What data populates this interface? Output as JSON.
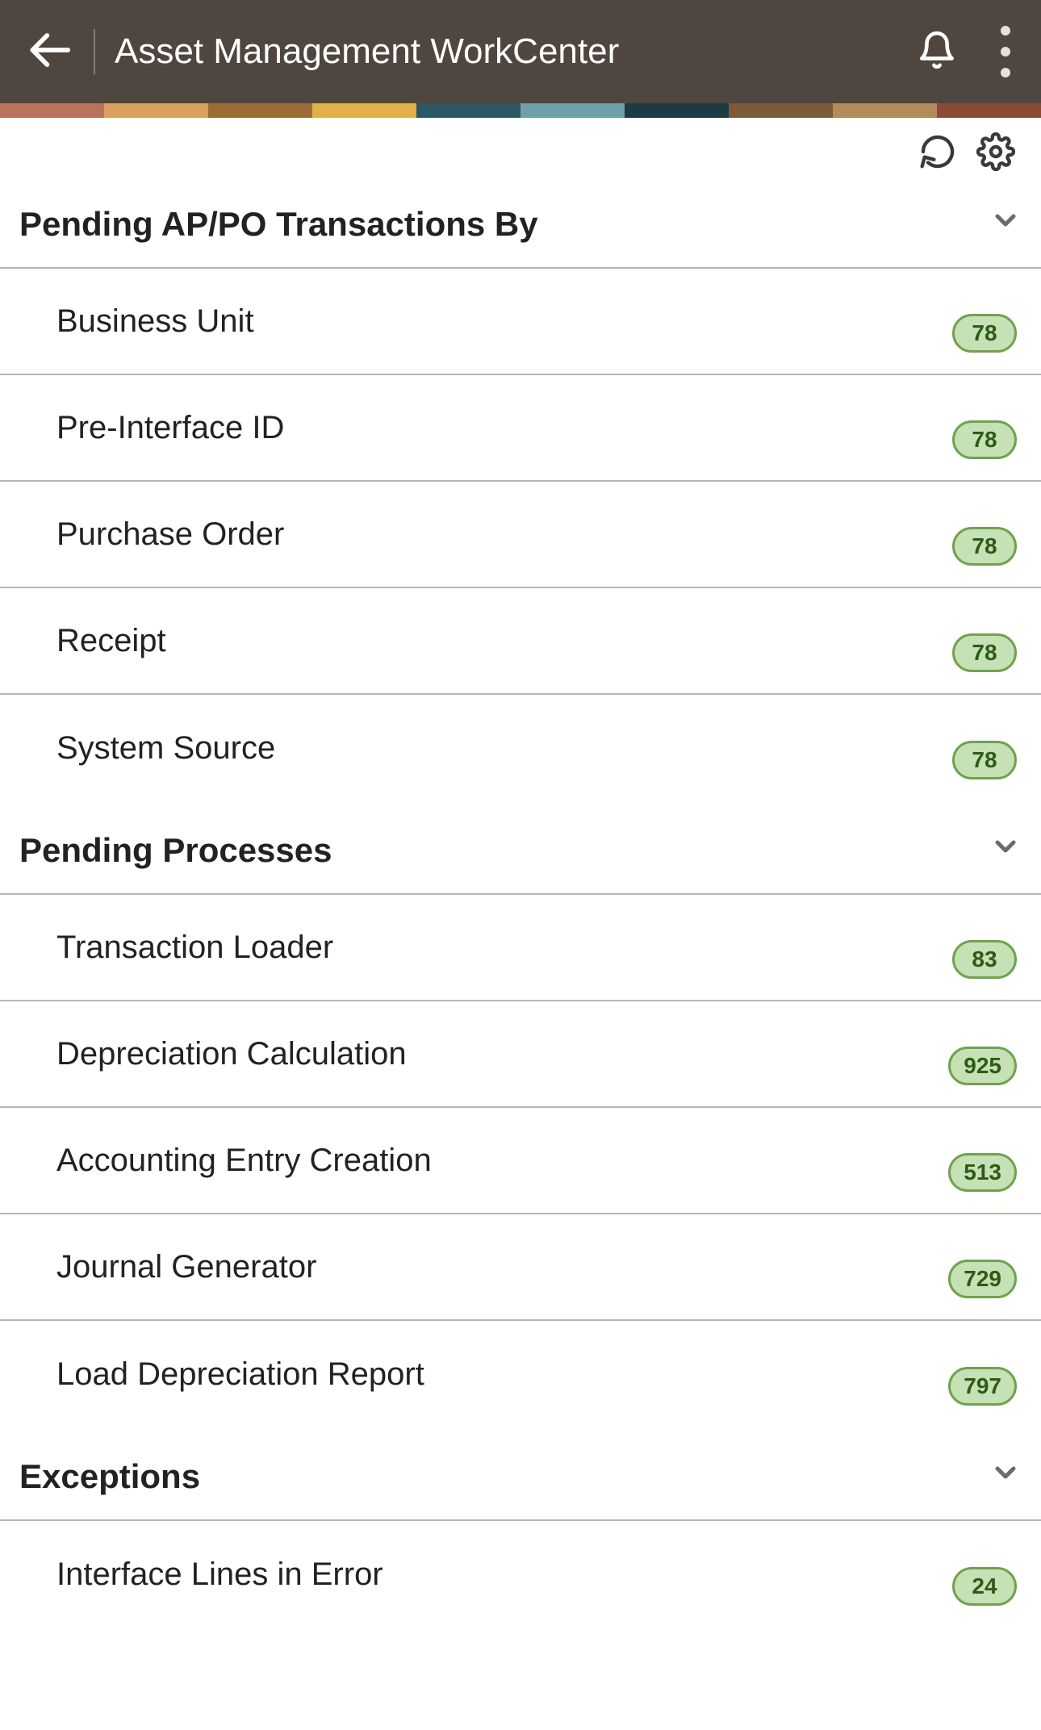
{
  "header": {
    "title": "Asset Management WorkCenter"
  },
  "sections": [
    {
      "title": "Pending AP/PO Transactions By",
      "items": [
        {
          "label": "Business Unit",
          "count": "78"
        },
        {
          "label": "Pre-Interface ID",
          "count": "78"
        },
        {
          "label": "Purchase Order",
          "count": "78"
        },
        {
          "label": "Receipt",
          "count": "78"
        },
        {
          "label": "System Source",
          "count": "78"
        }
      ]
    },
    {
      "title": "Pending Processes",
      "items": [
        {
          "label": "Transaction Loader",
          "count": "83"
        },
        {
          "label": "Depreciation Calculation",
          "count": "925"
        },
        {
          "label": "Accounting Entry Creation",
          "count": "513"
        },
        {
          "label": "Journal Generator",
          "count": "729"
        },
        {
          "label": "Load Depreciation Report",
          "count": "797"
        }
      ]
    },
    {
      "title": "Exceptions",
      "items": [
        {
          "label": "Interface Lines in Error",
          "count": "24"
        }
      ]
    }
  ]
}
